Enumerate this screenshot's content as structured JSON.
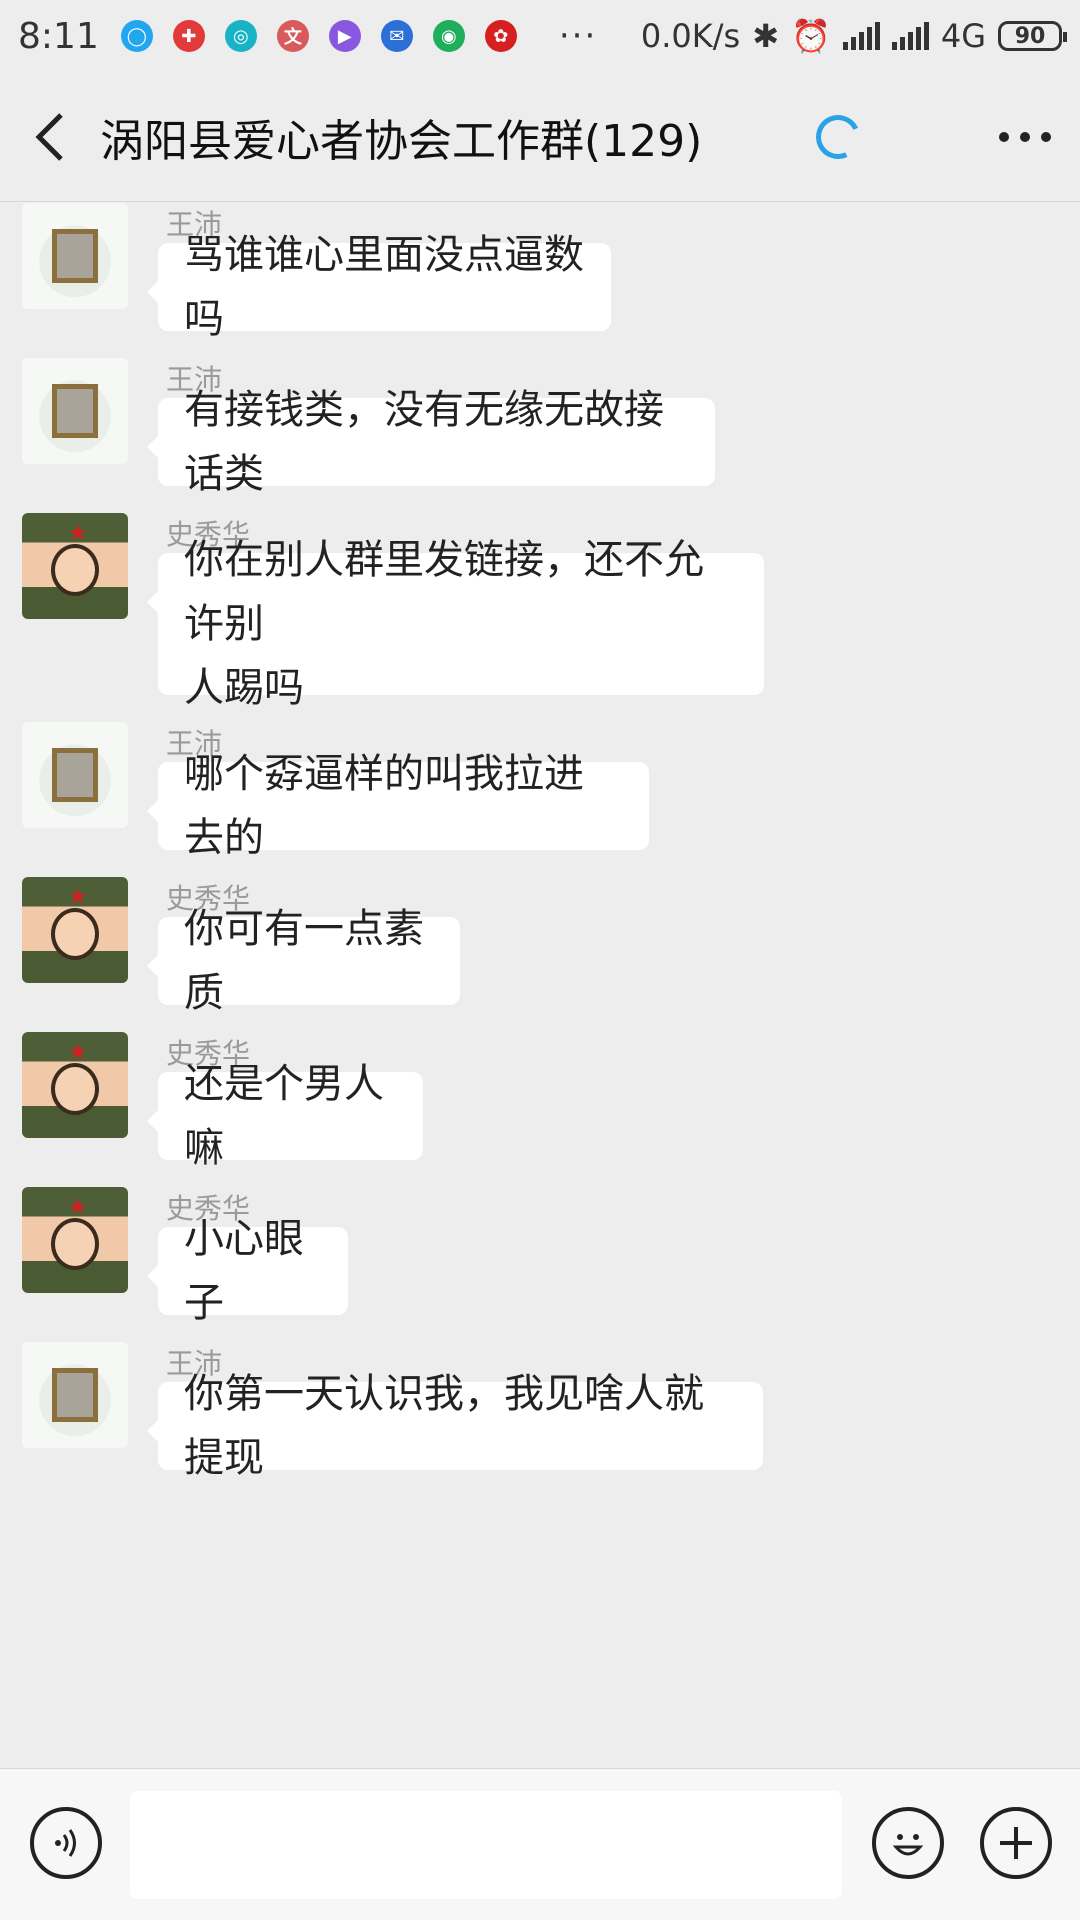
{
  "status_bar": {
    "time": "8:11",
    "app_icons": [
      {
        "icon": "qq-message-icon",
        "color": "#22a6ee",
        "glyph": "◯"
      },
      {
        "icon": "app-red-icon",
        "color": "#e23a3a",
        "glyph": "✚"
      },
      {
        "icon": "browser-icon",
        "color": "#19b3c6",
        "glyph": "◎"
      },
      {
        "icon": "text-app-icon",
        "color": "#d95a5a",
        "glyph": "文"
      },
      {
        "icon": "music-icon",
        "color": "#8a58e0",
        "glyph": "▶"
      },
      {
        "icon": "store-icon",
        "color": "#2d6fd8",
        "glyph": "✉"
      },
      {
        "icon": "maps-icon",
        "color": "#1fae5b",
        "glyph": "◉"
      },
      {
        "icon": "red-seal-icon",
        "color": "#d62020",
        "glyph": "✿"
      }
    ],
    "more": "···",
    "net_speed": "0.0K/s",
    "network": "4G",
    "battery": "90"
  },
  "header": {
    "title": "涡阳县爱心者协会工作群(129)",
    "loading_color": "#29a3e6"
  },
  "messages": [
    {
      "sender": "王沛",
      "avatar": "a",
      "lines": [
        "骂谁谁心里面没点逼数吗"
      ]
    },
    {
      "sender": "王沛",
      "avatar": "a",
      "lines": [
        "有接钱类，没有无缘无故接话类"
      ]
    },
    {
      "sender": "史秀华",
      "avatar": "b",
      "lines": [
        "你在别人群里发链接，还不允许别",
        "人踢吗"
      ]
    },
    {
      "sender": "王沛",
      "avatar": "a",
      "lines": [
        "哪个孬逼样的叫我拉进去的"
      ]
    },
    {
      "sender": "史秀华",
      "avatar": "b",
      "lines": [
        "你可有一点素质"
      ]
    },
    {
      "sender": "史秀华",
      "avatar": "b",
      "lines": [
        "还是个男人嘛"
      ]
    },
    {
      "sender": "史秀华",
      "avatar": "b",
      "lines": [
        "小心眼子"
      ]
    },
    {
      "sender": "王沛",
      "avatar": "a",
      "lines": [
        "你第一天认识我，我见啥人就提现"
      ]
    }
  ],
  "input": {
    "placeholder": "",
    "value": ""
  }
}
